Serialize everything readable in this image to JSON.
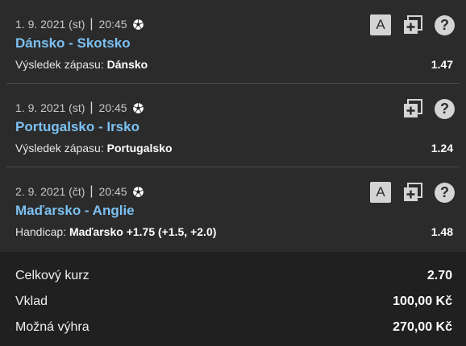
{
  "bets": [
    {
      "date": "1. 9. 2021 (st)",
      "time": "20:45",
      "sport_icon": "soccer-ball-icon",
      "match": "Dánsko - Skotsko",
      "market_label": "Výsledek zápasu:",
      "selection": "Dánsko",
      "odds": "1.47",
      "has_a_button": true,
      "a_label": "A"
    },
    {
      "date": "1. 9. 2021 (st)",
      "time": "20:45",
      "sport_icon": "soccer-ball-icon",
      "match": "Portugalsko - Irsko",
      "market_label": "Výsledek zápasu:",
      "selection": "Portugalsko",
      "odds": "1.24",
      "has_a_button": false,
      "a_label": ""
    },
    {
      "date": "2. 9. 2021 (čt)",
      "time": "20:45",
      "sport_icon": "soccer-ball-icon",
      "match": "Maďarsko - Anglie",
      "market_label": "Handicap:",
      "selection": "Maďarsko +1.75 (+1.5, +2.0)",
      "odds": "1.48",
      "has_a_button": true,
      "a_label": "A"
    }
  ],
  "summary": {
    "total_odds_label": "Celkový kurz",
    "total_odds_value": "2.70",
    "stake_label": "Vklad",
    "stake_value": "100,00 Kč",
    "win_label": "Možná výhra",
    "win_value": "270,00 Kč"
  },
  "help_glyph": "?",
  "colors": {
    "background": "#2b2b2b",
    "summary_background": "#202020",
    "match_link": "#7cc1f2",
    "button": "#d4d4d4"
  }
}
